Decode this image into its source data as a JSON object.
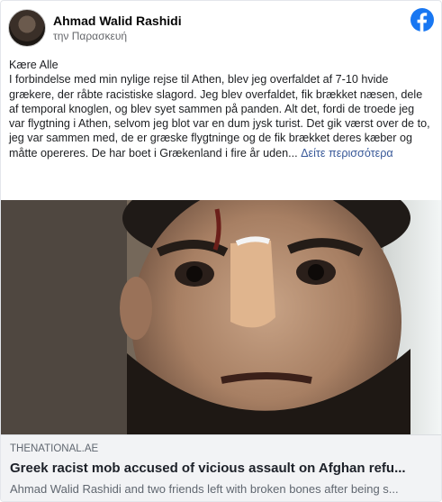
{
  "post": {
    "author": "Ahmad Walid Rashidi",
    "timestamp": "την Παρασκευή",
    "body_lines": [
      "Kære Alle",
      "I forbindelse med min nylige rejse til Athen, blev jeg overfaldet af 7-10 hvide grækere, der råbte racistiske slagord. Jeg blev overfaldet, fik brækket næsen, dele af temporal knoglen, og blev syet sammen på panden. Alt det, fordi de troede jeg var flygtning i Athen, selvom jeg blot var en dum jysk turist. Det gik værst over de to, jeg var sammen med, de er græske flygtninge og de fik brækket deres kæber og måtte opereres. De har boet i Grækenland i fire år uden..."
    ],
    "see_more": "Δείτε περισσότερα"
  },
  "link_preview": {
    "domain": "THENATIONAL.AE",
    "title": "Greek racist mob accused of vicious assault on Afghan refu...",
    "description": "Ahmad Walid Rashidi and two friends left with broken bones after being s..."
  },
  "brand": {
    "facebook_blue": "#1877f2",
    "icon": "facebook-logo-icon"
  }
}
